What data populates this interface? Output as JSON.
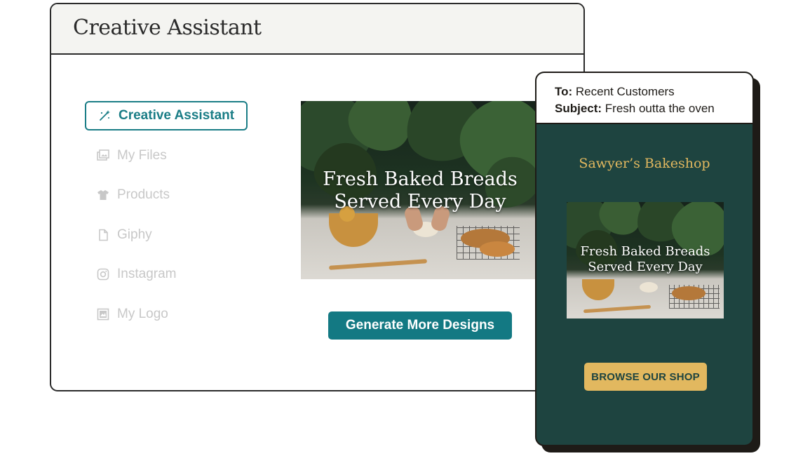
{
  "window": {
    "title": "Creative Assistant"
  },
  "sidebar": {
    "items": [
      {
        "label": "Creative Assistant",
        "icon": "magic-wand-icon",
        "active": true
      },
      {
        "label": "My Files",
        "icon": "images-icon",
        "active": false
      },
      {
        "label": "Products",
        "icon": "tshirt-icon",
        "active": false
      },
      {
        "label": "Giphy",
        "icon": "file-icon",
        "active": false
      },
      {
        "label": "Instagram",
        "icon": "instagram-icon",
        "active": false
      },
      {
        "label": "My Logo",
        "icon": "logo-image-icon",
        "active": false
      }
    ]
  },
  "preview": {
    "headline_line1": "Fresh Baked Breads",
    "headline_line2": "Served Every Day",
    "generate_button": "Generate More Designs"
  },
  "email": {
    "to_label": "To:",
    "to_value": "Recent Customers",
    "subject_label": "Subject:",
    "subject_value": "Fresh outta the oven",
    "shop_name": "Sawyer’s Bakeshop",
    "headline_line1": "Fresh Baked Breads",
    "headline_line2": "Served Every Day",
    "cta": "BROWSE OUR SHOP"
  },
  "colors": {
    "accent_teal": "#1a7d86",
    "button_teal": "#137983",
    "email_bg": "#1e4440",
    "gold": "#e2b85f"
  }
}
